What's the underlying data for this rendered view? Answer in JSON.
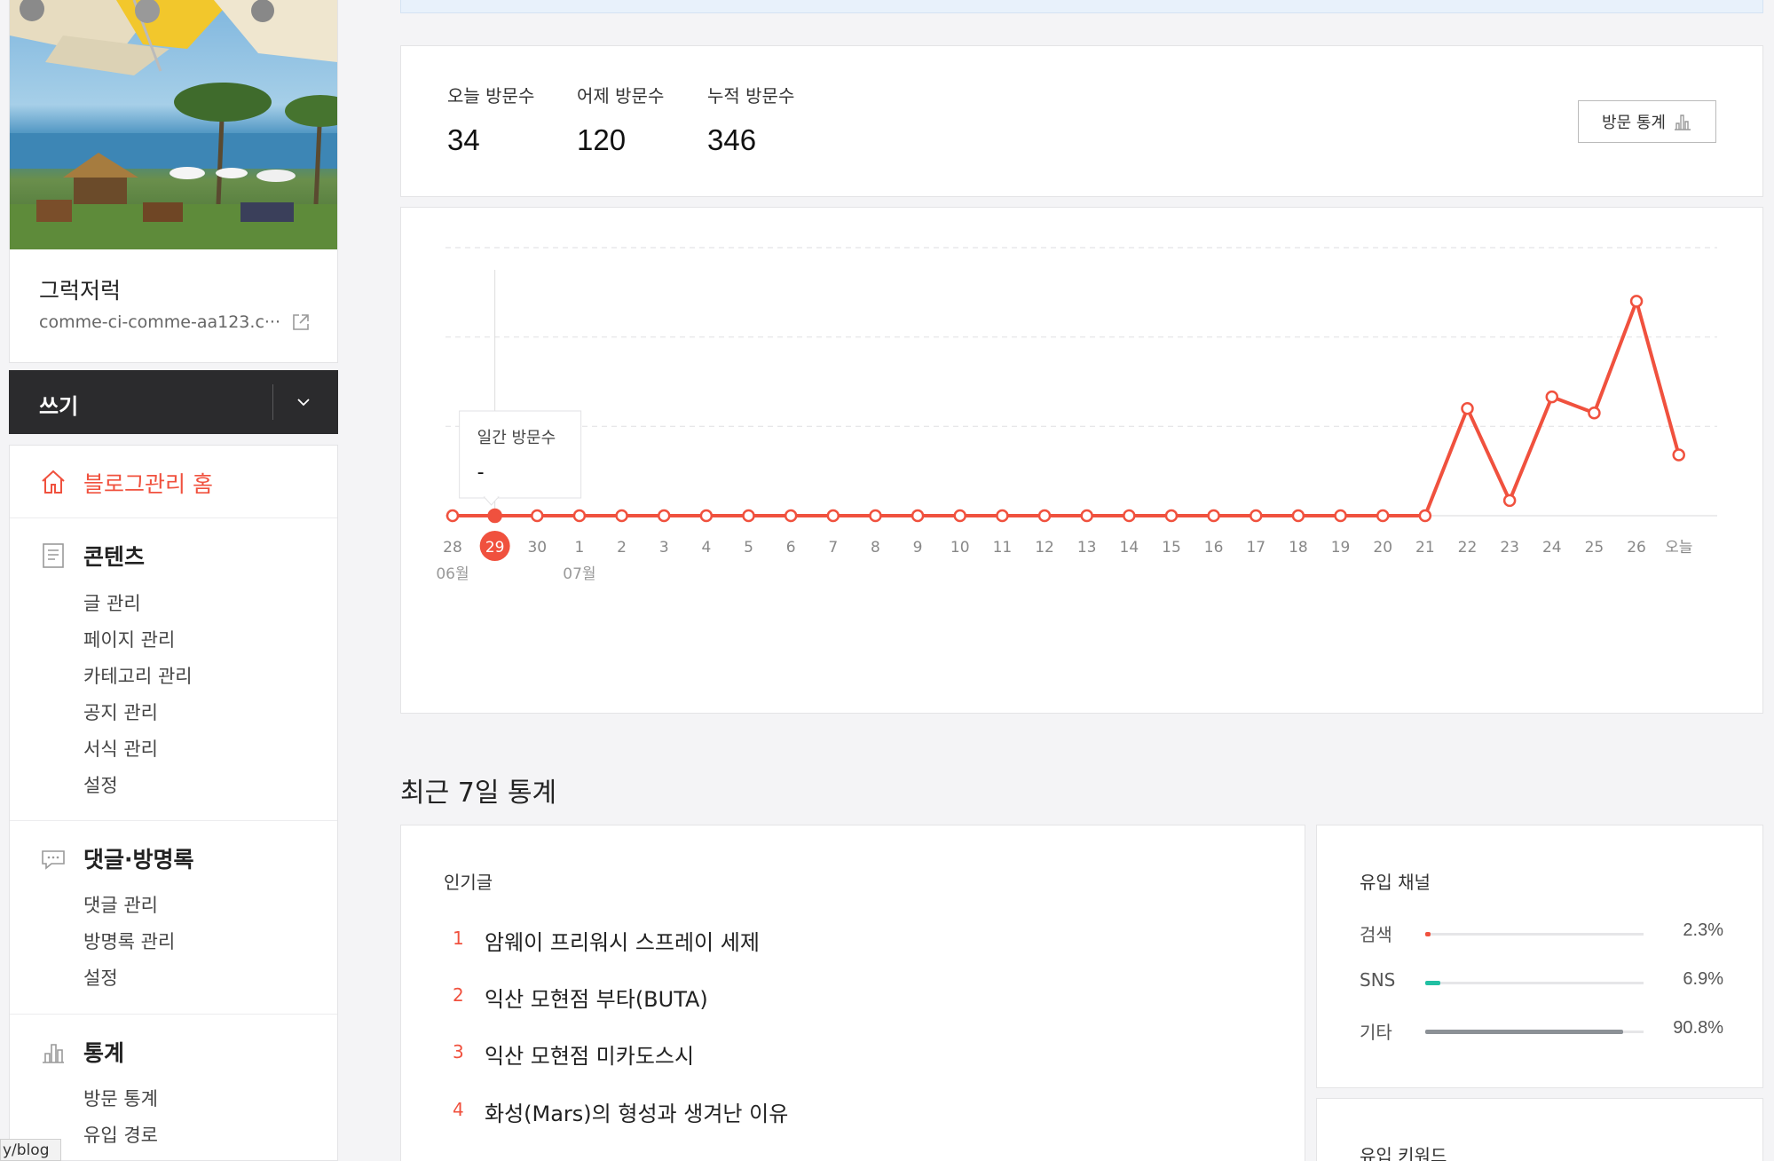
{
  "blog": {
    "name": "그럭저럭",
    "url": "comme-ci-comme-aa123.c···"
  },
  "write": {
    "label": "쓰기"
  },
  "menu": {
    "home": "블로그관리 홈",
    "contents": {
      "title": "콘텐츠",
      "items": [
        "글 관리",
        "페이지 관리",
        "카테고리 관리",
        "공지 관리",
        "서식 관리",
        "설정"
      ]
    },
    "comments": {
      "title": "댓글·방명록",
      "items": [
        "댓글 관리",
        "방명록 관리",
        "설정"
      ]
    },
    "stats": {
      "title": "통계",
      "items": [
        "방문 통계",
        "유입 경로"
      ]
    }
  },
  "status_url": "y/blog",
  "visits": {
    "today_label": "오늘 방문수",
    "today": "34",
    "yesterday_label": "어제 방문수",
    "yesterday": "120",
    "total_label": "누적 방문수",
    "total": "346",
    "stats_button": "방문 통계"
  },
  "chart_data": {
    "type": "line",
    "x": [
      "28",
      "29",
      "30",
      "1",
      "2",
      "3",
      "4",
      "5",
      "6",
      "7",
      "8",
      "9",
      "10",
      "11",
      "12",
      "13",
      "14",
      "15",
      "16",
      "17",
      "18",
      "19",
      "20",
      "21",
      "22",
      "23",
      "24",
      "25",
      "26",
      "오늘"
    ],
    "month_labels": [
      {
        "index": 0,
        "label": "06월"
      },
      {
        "index": 3,
        "label": "07월"
      }
    ],
    "series": [
      {
        "values": [
          0,
          0,
          0,
          0,
          0,
          0,
          0,
          0,
          0,
          0,
          0,
          0,
          0,
          0,
          0,
          0,
          0,
          0,
          0,
          0,
          0,
          0,
          0,
          0,
          120,
          17,
          133,
          115,
          240,
          68
        ]
      }
    ],
    "ylim": [
      0,
      300
    ],
    "grid": true,
    "highlight_index": 1,
    "tooltip": {
      "title": "일간 방문수",
      "value": "-"
    },
    "line_color": "#f0513e"
  },
  "recent": {
    "title": "최근 7일 통계",
    "popular": {
      "title": "인기글",
      "items": [
        {
          "rank": "1",
          "title": "암웨이 프리워시 스프레이 세제"
        },
        {
          "rank": "2",
          "title": "익산 모현점 부타(BUTA)"
        },
        {
          "rank": "3",
          "title": "익산 모현점 미카도스시"
        },
        {
          "rank": "4",
          "title": "화성(Mars)의 형성과 생겨난 이유"
        }
      ]
    },
    "channels": {
      "title": "유입 채널",
      "items": [
        {
          "label": "검색",
          "value": "2.3%",
          "fraction": 0.023,
          "color": "#f0513e"
        },
        {
          "label": "SNS",
          "value": "6.9%",
          "fraction": 0.069,
          "color": "#21c0a3"
        },
        {
          "label": "기타",
          "value": "90.8%",
          "fraction": 0.908,
          "color": "#8c9196"
        }
      ]
    },
    "keywords": {
      "title": "유입 키워드"
    }
  },
  "colors": {
    "accent": "#f0513e",
    "dark": "#2b2b2d"
  }
}
